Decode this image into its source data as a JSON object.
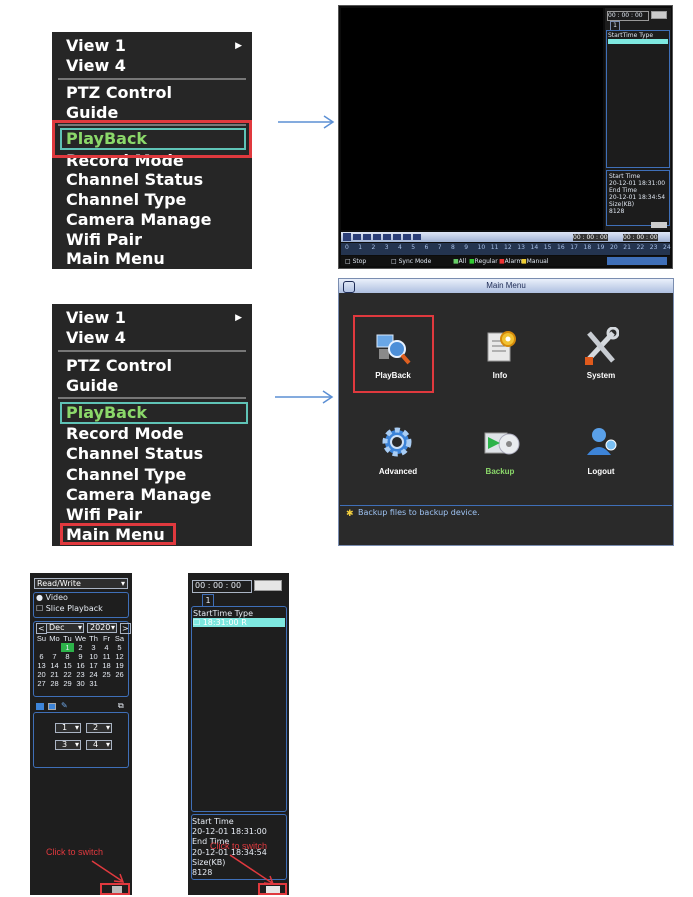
{
  "menu_1": {
    "items": [
      "View 1",
      "View 4",
      "PTZ Control",
      "Guide",
      "PlayBack",
      "Record Mode",
      "Channel Status",
      "Channel Type",
      "Camera Manage",
      "Wifi Pair",
      "Main Menu"
    ]
  },
  "menu_2": {
    "items": [
      "View 1",
      "View 4",
      "PTZ Control",
      "Guide",
      "PlayBack",
      "Record Mode",
      "Channel Status",
      "Channel Type",
      "Camera Manage",
      "Wifi Pair",
      "Main Menu"
    ]
  },
  "playback_screen": {
    "time": "00 : 00 : 00",
    "channel": "1",
    "list_header": "StartTime Type",
    "info": [
      "Start Time",
      "20-12-01 18:31:00",
      "End Time",
      "20-12-01 18:34:54",
      "Size(KB)",
      "8128"
    ],
    "timeline_ticks": [
      "0",
      "1",
      "2",
      "3",
      "4",
      "5",
      "6",
      "7",
      "8",
      "9",
      "10",
      "11",
      "12",
      "13",
      "14",
      "15",
      "16",
      "17",
      "18",
      "19",
      "20",
      "21",
      "22",
      "23",
      "24"
    ],
    "status_left": [
      "Stop",
      "Sync Mode"
    ],
    "legend": [
      "All",
      "Regular",
      "Alarm",
      "Manual"
    ],
    "time_from": "00 : 00 : 00",
    "time_to": "00 : 00 : 00"
  },
  "main_menu": {
    "title": "Main Menu",
    "items": [
      "PlayBack",
      "Info",
      "System",
      "Advanced",
      "Backup",
      "Logout"
    ],
    "status": "Backup files to backup device."
  },
  "left_panel": {
    "mode": "Read/Write",
    "radio_video": "Video",
    "check_slice": "Slice Playback",
    "month": "Dec",
    "year": "2020",
    "weekdays": [
      "Su",
      "Mo",
      "Tu",
      "We",
      "Th",
      "Fr",
      "Sa"
    ],
    "weeks": [
      [
        "",
        "",
        "1",
        "2",
        "3",
        "4",
        "5"
      ],
      [
        "6",
        "7",
        "8",
        "9",
        "10",
        "11",
        "12"
      ],
      [
        "13",
        "14",
        "15",
        "16",
        "17",
        "18",
        "19"
      ],
      [
        "20",
        "21",
        "22",
        "23",
        "24",
        "25",
        "26"
      ],
      [
        "27",
        "28",
        "29",
        "30",
        "31",
        "",
        ""
      ]
    ],
    "channels": [
      "1",
      "2",
      "3",
      "4"
    ],
    "hint": "Click to switch"
  },
  "right_panel": {
    "time": "00 : 00 : 00",
    "channel": "1",
    "list_header": "StartTime Type",
    "row": "18:31:00 R",
    "info": [
      "Start Time",
      "20-12-01 18:31:00",
      "End Time",
      "20-12-01 18:34:54",
      "Size(KB)",
      "8128"
    ],
    "hint": "Click to switch"
  },
  "colors": {
    "highlight_red": "#e0393e",
    "playback_green": "#8bd86a",
    "arrow_blue": "#5b8fd4"
  }
}
